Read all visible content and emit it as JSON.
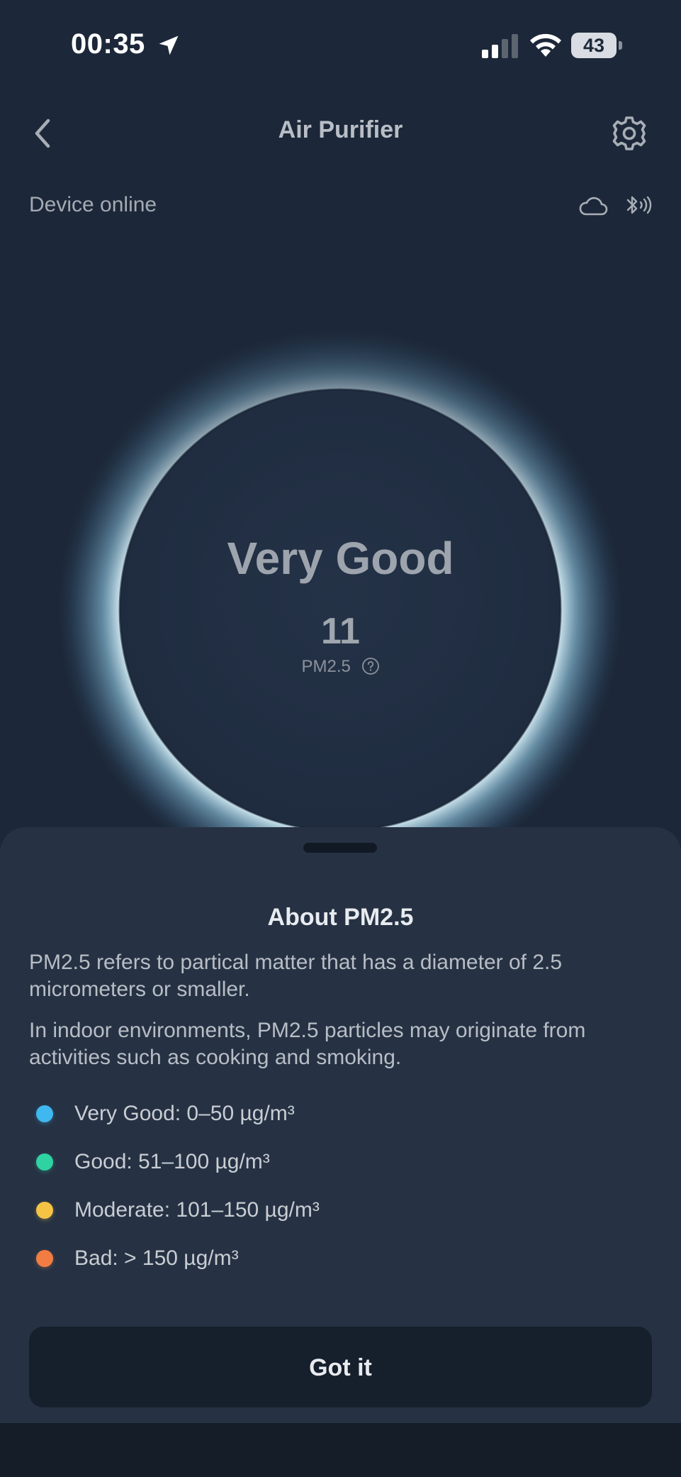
{
  "status_bar": {
    "time": "00:35",
    "battery": "43"
  },
  "header": {
    "title": "Air Purifier"
  },
  "device": {
    "status": "Device online"
  },
  "gauge": {
    "quality": "Very Good",
    "value": "11",
    "unit_label": "PM2.5"
  },
  "sheet": {
    "title": "About PM2.5",
    "paragraph_1": " PM2.5 refers to partical matter that has a diameter of 2.5 micrometers or smaller.",
    "paragraph_2": " In indoor environments, PM2.5 particles may originate from activities such as cooking and smoking.",
    "levels": [
      {
        "label": "Very Good: 0–50 µg/m³",
        "color": "#3fb8f0"
      },
      {
        "label": "Good: 51–100 µg/m³",
        "color": "#2fd3a2"
      },
      {
        "label": "Moderate: 101–150 µg/m³",
        "color": "#f5c445"
      },
      {
        "label": "Bad: > 150 µg/m³",
        "color": "#f27d43"
      }
    ],
    "button_label": "Got it"
  },
  "colors": {
    "background": "#1c2839",
    "sheet": "#263244",
    "ring_glow": "#a9d3e6"
  },
  "icons": {
    "back": "chevron-left-icon",
    "settings": "gear-icon",
    "cloud": "cloud-icon",
    "bluetooth": "bluetooth-icon",
    "help": "question-circle-icon",
    "location": "location-arrow-icon"
  }
}
